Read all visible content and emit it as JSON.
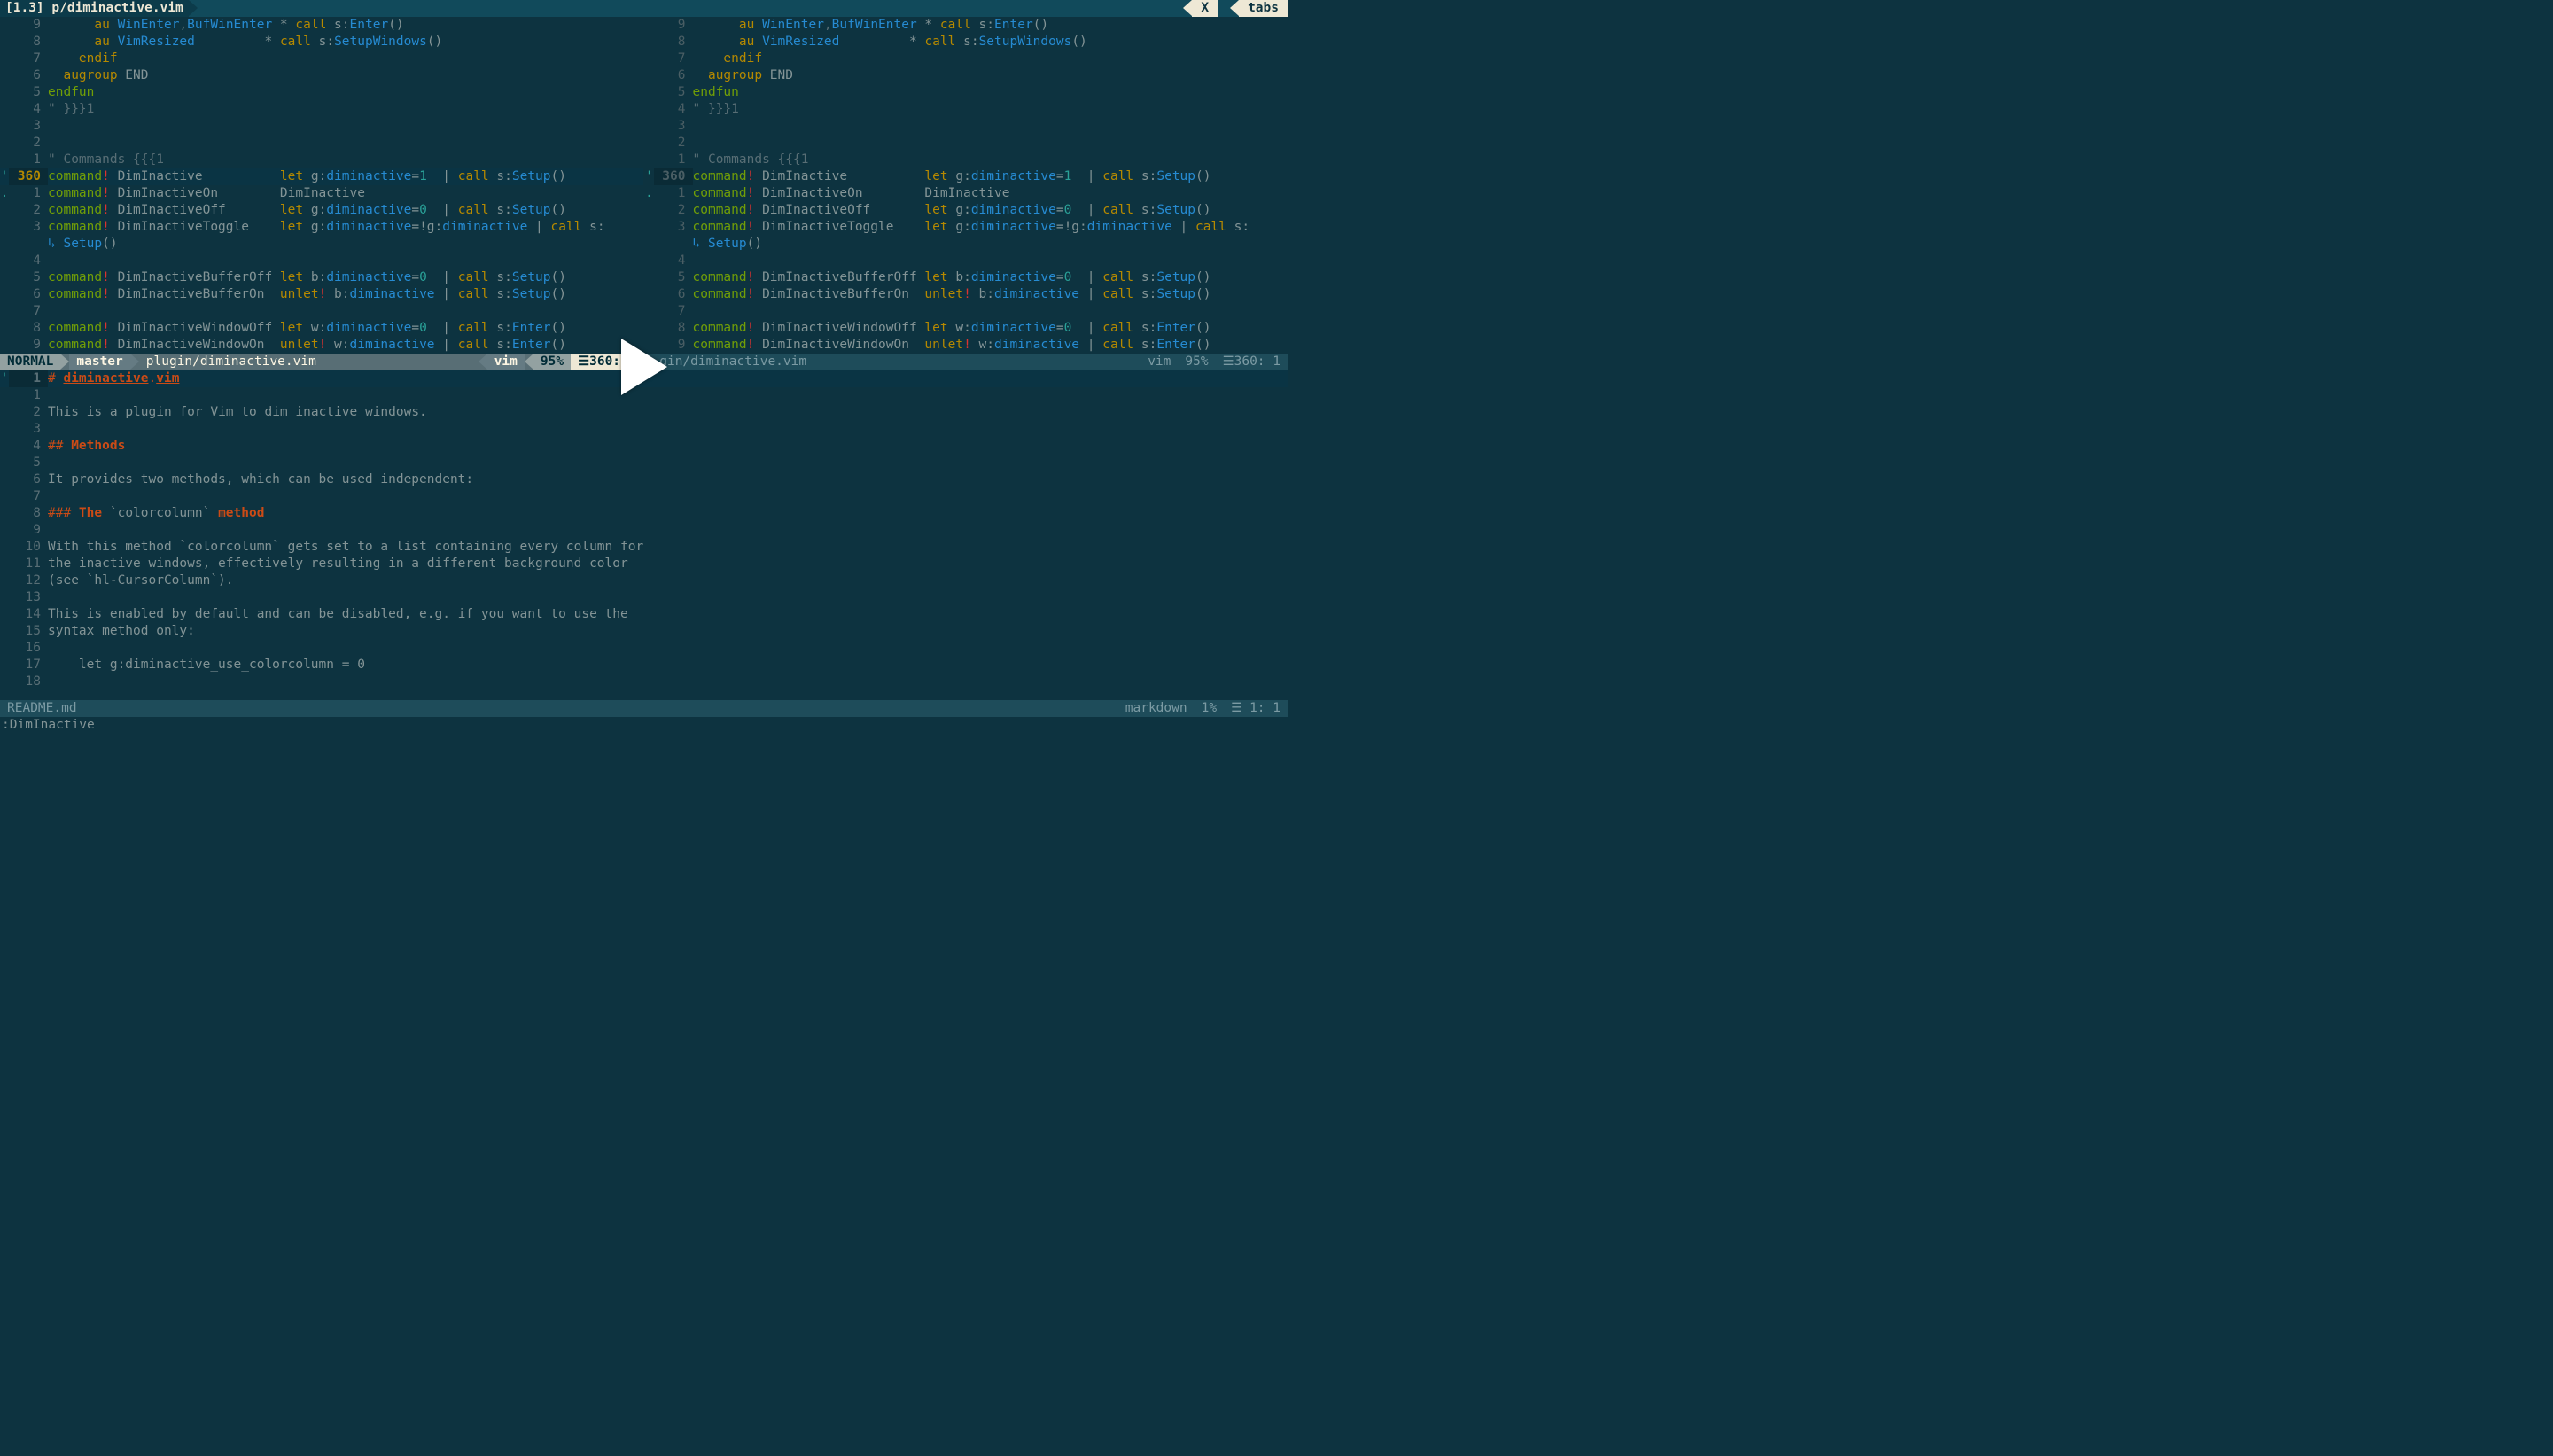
{
  "tabline": {
    "active_label": "[1.3] p/diminactive.vim",
    "close_label": "X",
    "tabs_label": "tabs"
  },
  "panes": {
    "left": {
      "lines": [
        {
          "n": "9",
          "m": "",
          "segs": [
            {
              "t": "      ",
              "c": ""
            },
            {
              "t": "au",
              "c": "typ"
            },
            {
              "t": " ",
              "c": ""
            },
            {
              "t": "WinEnter",
              "c": "id"
            },
            {
              "t": ",",
              "c": "op"
            },
            {
              "t": "BufWinEnter",
              "c": "id"
            },
            {
              "t": " * ",
              "c": ""
            },
            {
              "t": "call",
              "c": "typ"
            },
            {
              "t": " s:",
              "c": ""
            },
            {
              "t": "Enter",
              "c": "id"
            },
            {
              "t": "()",
              "c": ""
            }
          ]
        },
        {
          "n": "8",
          "m": "",
          "segs": [
            {
              "t": "      ",
              "c": ""
            },
            {
              "t": "au",
              "c": "typ"
            },
            {
              "t": " ",
              "c": ""
            },
            {
              "t": "VimResized",
              "c": "id"
            },
            {
              "t": "         * ",
              "c": ""
            },
            {
              "t": "call",
              "c": "typ"
            },
            {
              "t": " s:",
              "c": ""
            },
            {
              "t": "SetupWindows",
              "c": "id"
            },
            {
              "t": "()",
              "c": ""
            }
          ]
        },
        {
          "n": "7",
          "m": "",
          "segs": [
            {
              "t": "    ",
              "c": ""
            },
            {
              "t": "endif",
              "c": "typ"
            }
          ]
        },
        {
          "n": "6",
          "m": "",
          "segs": [
            {
              "t": "  ",
              "c": ""
            },
            {
              "t": "augroup",
              "c": "typ"
            },
            {
              "t": " END",
              "c": ""
            }
          ]
        },
        {
          "n": "5",
          "m": "",
          "segs": [
            {
              "t": "endfun",
              "c": "kw"
            }
          ]
        },
        {
          "n": "4",
          "m": "",
          "segs": [
            {
              "t": "\" }}}1",
              "c": "cm"
            }
          ]
        },
        {
          "n": "3",
          "m": "",
          "segs": [
            {
              "t": "",
              "c": ""
            }
          ]
        },
        {
          "n": "2",
          "m": "",
          "segs": [
            {
              "t": "",
              "c": ""
            }
          ]
        },
        {
          "n": "1",
          "m": "",
          "segs": [
            {
              "t": "\" Commands {{{1",
              "c": "cm"
            }
          ]
        },
        {
          "n": "360",
          "m": "'",
          "cur": true,
          "segs": [
            {
              "t": "command",
              "c": "kw"
            },
            {
              "t": "!",
              "c": "br"
            },
            {
              "t": " DimInactive          ",
              "c": ""
            },
            {
              "t": "let",
              "c": "typ"
            },
            {
              "t": " g:",
              "c": ""
            },
            {
              "t": "diminactive",
              "c": "id"
            },
            {
              "t": "=",
              "c": ""
            },
            {
              "t": "1",
              "c": "num"
            },
            {
              "t": "  | ",
              "c": ""
            },
            {
              "t": "call",
              "c": "typ"
            },
            {
              "t": " s:",
              "c": ""
            },
            {
              "t": "Setup",
              "c": "id"
            },
            {
              "t": "()",
              "c": ""
            }
          ]
        },
        {
          "n": "1",
          "m": ".",
          "segs": [
            {
              "t": "command",
              "c": "kw"
            },
            {
              "t": "!",
              "c": "br"
            },
            {
              "t": " DimInactiveOn        DimInactive",
              "c": ""
            }
          ]
        },
        {
          "n": "2",
          "m": "",
          "segs": [
            {
              "t": "command",
              "c": "kw"
            },
            {
              "t": "!",
              "c": "br"
            },
            {
              "t": " DimInactiveOff       ",
              "c": ""
            },
            {
              "t": "let",
              "c": "typ"
            },
            {
              "t": " g:",
              "c": ""
            },
            {
              "t": "diminactive",
              "c": "id"
            },
            {
              "t": "=",
              "c": ""
            },
            {
              "t": "0",
              "c": "num"
            },
            {
              "t": "  | ",
              "c": ""
            },
            {
              "t": "call",
              "c": "typ"
            },
            {
              "t": " s:",
              "c": ""
            },
            {
              "t": "Setup",
              "c": "id"
            },
            {
              "t": "()",
              "c": ""
            }
          ]
        },
        {
          "n": "3",
          "m": "",
          "segs": [
            {
              "t": "command",
              "c": "kw"
            },
            {
              "t": "!",
              "c": "br"
            },
            {
              "t": " DimInactiveToggle    ",
              "c": ""
            },
            {
              "t": "let",
              "c": "typ"
            },
            {
              "t": " g:",
              "c": ""
            },
            {
              "t": "diminactive",
              "c": "id"
            },
            {
              "t": "=!g:",
              "c": ""
            },
            {
              "t": "diminactive",
              "c": "id"
            },
            {
              "t": " | ",
              "c": ""
            },
            {
              "t": "call",
              "c": "typ"
            },
            {
              "t": " s:",
              "c": ""
            }
          ]
        },
        {
          "n": "",
          "m": "",
          "segs": [
            {
              "t": "↳ ",
              "c": "wrap"
            },
            {
              "t": "Setup",
              "c": "id"
            },
            {
              "t": "()",
              "c": ""
            }
          ]
        },
        {
          "n": "4",
          "m": "",
          "segs": [
            {
              "t": "",
              "c": ""
            }
          ]
        },
        {
          "n": "5",
          "m": "",
          "segs": [
            {
              "t": "command",
              "c": "kw"
            },
            {
              "t": "!",
              "c": "br"
            },
            {
              "t": " DimInactiveBufferOff ",
              "c": ""
            },
            {
              "t": "let",
              "c": "typ"
            },
            {
              "t": " b:",
              "c": ""
            },
            {
              "t": "diminactive",
              "c": "id"
            },
            {
              "t": "=",
              "c": ""
            },
            {
              "t": "0",
              "c": "num"
            },
            {
              "t": "  | ",
              "c": ""
            },
            {
              "t": "call",
              "c": "typ"
            },
            {
              "t": " s:",
              "c": ""
            },
            {
              "t": "Setup",
              "c": "id"
            },
            {
              "t": "()",
              "c": ""
            }
          ]
        },
        {
          "n": "6",
          "m": "",
          "segs": [
            {
              "t": "command",
              "c": "kw"
            },
            {
              "t": "!",
              "c": "br"
            },
            {
              "t": " DimInactiveBufferOn  ",
              "c": ""
            },
            {
              "t": "unlet",
              "c": "typ"
            },
            {
              "t": "!",
              "c": "br"
            },
            {
              "t": " b:",
              "c": ""
            },
            {
              "t": "diminactive",
              "c": "id"
            },
            {
              "t": " | ",
              "c": ""
            },
            {
              "t": "call",
              "c": "typ"
            },
            {
              "t": " s:",
              "c": ""
            },
            {
              "t": "Setup",
              "c": "id"
            },
            {
              "t": "()",
              "c": ""
            }
          ]
        },
        {
          "n": "7",
          "m": "",
          "segs": [
            {
              "t": "",
              "c": ""
            }
          ]
        },
        {
          "n": "8",
          "m": "",
          "segs": [
            {
              "t": "command",
              "c": "kw"
            },
            {
              "t": "!",
              "c": "br"
            },
            {
              "t": " DimInactiveWindowOff ",
              "c": ""
            },
            {
              "t": "let",
              "c": "typ"
            },
            {
              "t": " w:",
              "c": ""
            },
            {
              "t": "diminactive",
              "c": "id"
            },
            {
              "t": "=",
              "c": ""
            },
            {
              "t": "0",
              "c": "num"
            },
            {
              "t": "  | ",
              "c": ""
            },
            {
              "t": "call",
              "c": "typ"
            },
            {
              "t": " s:",
              "c": ""
            },
            {
              "t": "Enter",
              "c": "id"
            },
            {
              "t": "()",
              "c": ""
            }
          ]
        },
        {
          "n": "9",
          "m": "",
          "segs": [
            {
              "t": "command",
              "c": "kw"
            },
            {
              "t": "!",
              "c": "br"
            },
            {
              "t": " DimInactiveWindowOn  ",
              "c": ""
            },
            {
              "t": "unlet",
              "c": "typ"
            },
            {
              "t": "!",
              "c": "br"
            },
            {
              "t": " w:",
              "c": ""
            },
            {
              "t": "diminactive",
              "c": "id"
            },
            {
              "t": " | ",
              "c": ""
            },
            {
              "t": "call",
              "c": "typ"
            },
            {
              "t": " s:",
              "c": ""
            },
            {
              "t": "Enter",
              "c": "id"
            },
            {
              "t": "()",
              "c": ""
            }
          ]
        }
      ],
      "status": {
        "mode": "NORMAL",
        "branch_icon": "",
        "branch": "master",
        "file": "plugin/diminactive.vim",
        "ft": "vim",
        "pct": "95%",
        "pos_icon": "☰",
        "pos": "360: 1"
      }
    },
    "right": {
      "lines_key": "panes.left.lines",
      "status": {
        "file": "…gin/diminactive.vim",
        "ft": "vim",
        "pct": "95%",
        "pos_icon": "☰",
        "pos": "360: 1"
      }
    }
  },
  "readme": {
    "lines": [
      {
        "n": "1",
        "m": "'",
        "cur": true,
        "segs": [
          {
            "t": "# ",
            "c": "hpre"
          },
          {
            "t": "diminactive",
            "c": "h1"
          },
          {
            "t": ".",
            "c": "hpre"
          },
          {
            "t": "vim",
            "c": "h1"
          }
        ]
      },
      {
        "n": "1",
        "segs": [
          {
            "t": "",
            "c": ""
          }
        ]
      },
      {
        "n": "2",
        "segs": [
          {
            "t": "This is a ",
            "c": ""
          },
          {
            "t": "plugin",
            "c": "ul"
          },
          {
            "t": " for Vim to dim inactive windows.",
            "c": ""
          }
        ]
      },
      {
        "n": "3",
        "segs": [
          {
            "t": "",
            "c": ""
          }
        ]
      },
      {
        "n": "4",
        "segs": [
          {
            "t": "## ",
            "c": "hpre"
          },
          {
            "t": "Methods",
            "c": "h2"
          }
        ]
      },
      {
        "n": "5",
        "segs": [
          {
            "t": "",
            "c": ""
          }
        ]
      },
      {
        "n": "6",
        "segs": [
          {
            "t": "It provides two methods, which can be used independent:",
            "c": ""
          }
        ]
      },
      {
        "n": "7",
        "segs": [
          {
            "t": "",
            "c": ""
          }
        ]
      },
      {
        "n": "8",
        "segs": [
          {
            "t": "### ",
            "c": "hpre"
          },
          {
            "t": "The",
            "c": "h2"
          },
          {
            "t": " `colorcolumn` ",
            "c": "codeinl"
          },
          {
            "t": "method",
            "c": "h2"
          }
        ]
      },
      {
        "n": "9",
        "segs": [
          {
            "t": "",
            "c": ""
          }
        ]
      },
      {
        "n": "10",
        "segs": [
          {
            "t": "With this method `colorcolumn` gets set to a list containing every column for",
            "c": ""
          }
        ]
      },
      {
        "n": "11",
        "segs": [
          {
            "t": "the inactive windows, effectively resulting in a different background color",
            "c": ""
          }
        ]
      },
      {
        "n": "12",
        "segs": [
          {
            "t": "(see `hl-CursorColumn`).",
            "c": ""
          }
        ]
      },
      {
        "n": "13",
        "segs": [
          {
            "t": "",
            "c": ""
          }
        ]
      },
      {
        "n": "14",
        "segs": [
          {
            "t": "This is enabled by default and can be disabled, e.g. if you want to use the",
            "c": ""
          }
        ]
      },
      {
        "n": "15",
        "segs": [
          {
            "t": "syntax method only:",
            "c": ""
          }
        ]
      },
      {
        "n": "16",
        "segs": [
          {
            "t": "",
            "c": ""
          }
        ]
      },
      {
        "n": "17",
        "segs": [
          {
            "t": "    let g:diminactive_use_colorcolumn = 0",
            "c": ""
          }
        ]
      },
      {
        "n": "18",
        "segs": [
          {
            "t": "",
            "c": ""
          }
        ]
      }
    ],
    "status": {
      "file": "README.md",
      "ft": "markdown",
      "pct": "1%",
      "pos_icon": "☰",
      "pos": "1: 1"
    }
  },
  "cmdline": ":DimInactive"
}
